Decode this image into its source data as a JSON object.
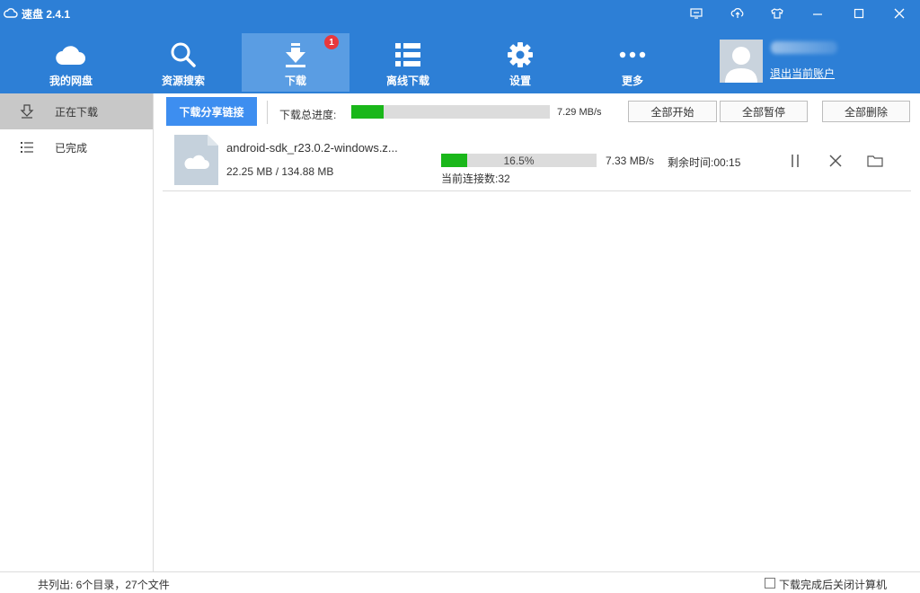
{
  "app": {
    "title": "速盘 2.4.1"
  },
  "nav": {
    "items": [
      {
        "label": "我的网盘",
        "icon": "cloud-icon"
      },
      {
        "label": "资源搜索",
        "icon": "search-icon"
      },
      {
        "label": "下载",
        "icon": "download-icon",
        "badge": "1",
        "active": true
      },
      {
        "label": "离线下载",
        "icon": "list-grid-icon"
      },
      {
        "label": "设置",
        "icon": "gear-icon"
      },
      {
        "label": "更多",
        "icon": "more-dots-icon"
      }
    ]
  },
  "account": {
    "logout_label": "退出当前账户"
  },
  "sidebar": {
    "items": [
      {
        "label": "正在下载",
        "icon": "download-arrow-icon",
        "active": true
      },
      {
        "label": "已完成",
        "icon": "list-icon"
      }
    ]
  },
  "toolbar": {
    "share_label": "下载分享链接",
    "total_label": "下载总进度:",
    "total_speed": "7.29 MB/s",
    "total_progress": 0.165,
    "start_all": "全部开始",
    "pause_all": "全部暂停",
    "delete_all": "全部删除"
  },
  "downloads": [
    {
      "name": "android-sdk_r23.0.2-windows.z...",
      "size": "22.25 MB / 134.88 MB",
      "progress": 0.165,
      "percent": "16.5%",
      "speed": "7.33 MB/s",
      "remaining": "剩余时间:00:15",
      "connections": "当前连接数:32"
    }
  ],
  "status": {
    "summary": "共列出: 6个目录，27个文件",
    "shutdown_label": "下载完成后关闭计算机"
  },
  "colors": {
    "header": "#2d7fd6",
    "accent": "#3d8ef0",
    "progress": "#1ab71a",
    "badge": "#e8383d"
  }
}
